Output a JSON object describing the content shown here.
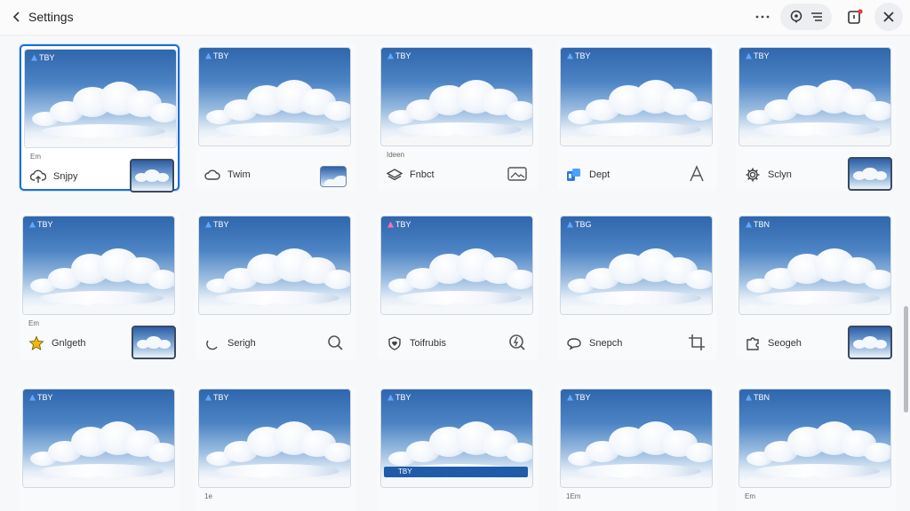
{
  "app": {
    "title": "Settings"
  },
  "colors": {
    "accent": "#1d6fd6",
    "sky_top": "#2f66ad",
    "sky_mid": "#9fc0e2"
  },
  "header": {
    "back_icon": "chevron-left-icon",
    "more_icon": "more-horizontal-icon",
    "pill_icons": [
      "location-pin-icon",
      "menu-lines-icon"
    ],
    "notification_icon": "notification-icon",
    "close_icon": "close-icon"
  },
  "cards": [
    {
      "badge": "TBY",
      "caption": "Em",
      "label": "Snjpy",
      "icon": "cloud-upload-icon",
      "action": "thumbnail-selected",
      "selected": true
    },
    {
      "badge": "TBY",
      "caption": "",
      "label": "Twim",
      "icon": "cloud-icon",
      "action": "thumbnail-small",
      "selected": false
    },
    {
      "badge": "TBY",
      "caption": "Ideen",
      "label": "Fnbct",
      "icon": "layers-icon",
      "action": "image-placeholder-icon",
      "selected": false
    },
    {
      "badge": "TBY",
      "caption": "",
      "label": "Dept",
      "icon": "colored-app-icon",
      "action": "text-a-icon",
      "selected": false
    },
    {
      "badge": "TBY",
      "caption": "",
      "label": "Sclyn",
      "icon": "gear-icon",
      "action": "thumbnail-selected",
      "selected": false
    },
    {
      "badge": "TBY",
      "caption": "Em",
      "label": "Gnlgeth",
      "icon": "star-icon",
      "action": "thumbnail-selected",
      "selected": false
    },
    {
      "badge": "TBY",
      "caption": "",
      "label": "Serigh",
      "icon": "crescent-icon",
      "action": "search-icon",
      "selected": false
    },
    {
      "badge": "TBY",
      "caption": "",
      "label": "Toifrubis",
      "icon": "shield-heart-icon",
      "action": "search-zap-icon",
      "selected": false
    },
    {
      "badge": "TBG",
      "caption": "",
      "label": "Snepch",
      "icon": "chat-bubble-icon",
      "action": "crop-icon",
      "selected": false
    },
    {
      "badge": "TBN",
      "caption": "",
      "label": "Seogeh",
      "icon": "puzzle-icon",
      "action": "thumbnail-selected",
      "selected": false
    },
    {
      "badge": "TBY",
      "caption": "",
      "label": "",
      "icon": "",
      "action": "",
      "selected": false
    },
    {
      "badge": "TBY",
      "caption": "1e",
      "label": "",
      "icon": "",
      "action": "",
      "selected": false
    },
    {
      "badge": "TBY",
      "caption": "",
      "label": "",
      "icon": "",
      "action": "",
      "selected": false
    },
    {
      "badge": "TBY",
      "caption": "1Em",
      "label": "",
      "icon": "",
      "action": "",
      "selected": false
    },
    {
      "badge": "TBN",
      "caption": "Em",
      "label": "",
      "icon": "",
      "action": "",
      "selected": false
    }
  ],
  "bottom_tab": {
    "label": "TBY"
  }
}
